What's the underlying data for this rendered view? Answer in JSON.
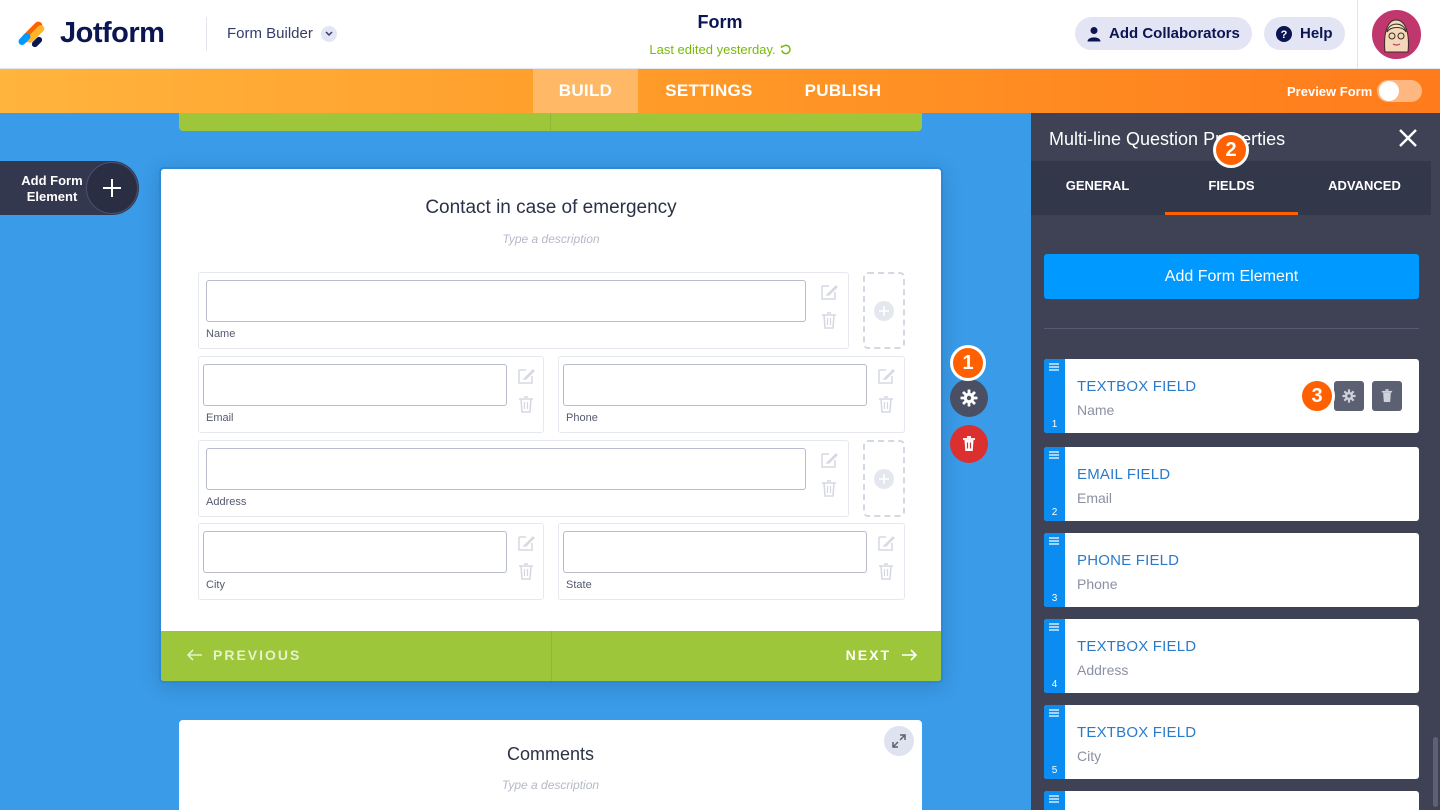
{
  "header": {
    "brand": "Jotform",
    "builder_label": "Form Builder",
    "form_title": "Form",
    "last_edited": "Last edited yesterday.",
    "collaborators_label": "Add Collaborators",
    "help_label": "Help"
  },
  "nav": {
    "tabs": [
      {
        "label": "BUILD",
        "active": true
      },
      {
        "label": "SETTINGS",
        "active": false
      },
      {
        "label": "PUBLISH",
        "active": false
      }
    ],
    "preview_label": "Preview Form"
  },
  "canvas": {
    "add_element_label": "Add Form Element",
    "card": {
      "title": "Contact in case of emergency",
      "description_placeholder": "Type a description",
      "fields": [
        {
          "label": "Name"
        },
        {
          "label": "Email"
        },
        {
          "label": "Phone"
        },
        {
          "label": "Address"
        },
        {
          "label": "City"
        },
        {
          "label": "State"
        }
      ],
      "previous_label": "PREVIOUS",
      "next_label": "NEXT"
    },
    "next_card": {
      "title": "Comments",
      "description_placeholder": "Type a description"
    }
  },
  "badges": [
    "1",
    "2",
    "3"
  ],
  "panel": {
    "title": "Multi-line Question Properties",
    "tabs": [
      {
        "label": "GENERAL",
        "active": false
      },
      {
        "label": "FIELDS",
        "active": true
      },
      {
        "label": "ADVANCED",
        "active": false
      }
    ],
    "add_button_label": "Add Form Element",
    "items": [
      {
        "num": "1",
        "type": "TEXTBOX FIELD",
        "name": "Name"
      },
      {
        "num": "2",
        "type": "EMAIL FIELD",
        "name": "Email"
      },
      {
        "num": "3",
        "type": "PHONE FIELD",
        "name": "Phone"
      },
      {
        "num": "4",
        "type": "TEXTBOX FIELD",
        "name": "Address"
      },
      {
        "num": "5",
        "type": "TEXTBOX FIELD",
        "name": "City"
      }
    ]
  },
  "colors": {
    "brand_orange": "#ff6100",
    "canvas_blue": "#3a9be8",
    "accent_green": "#9dc63a",
    "panel_dark": "#3e4254",
    "field_blue": "#0a8cf0"
  }
}
